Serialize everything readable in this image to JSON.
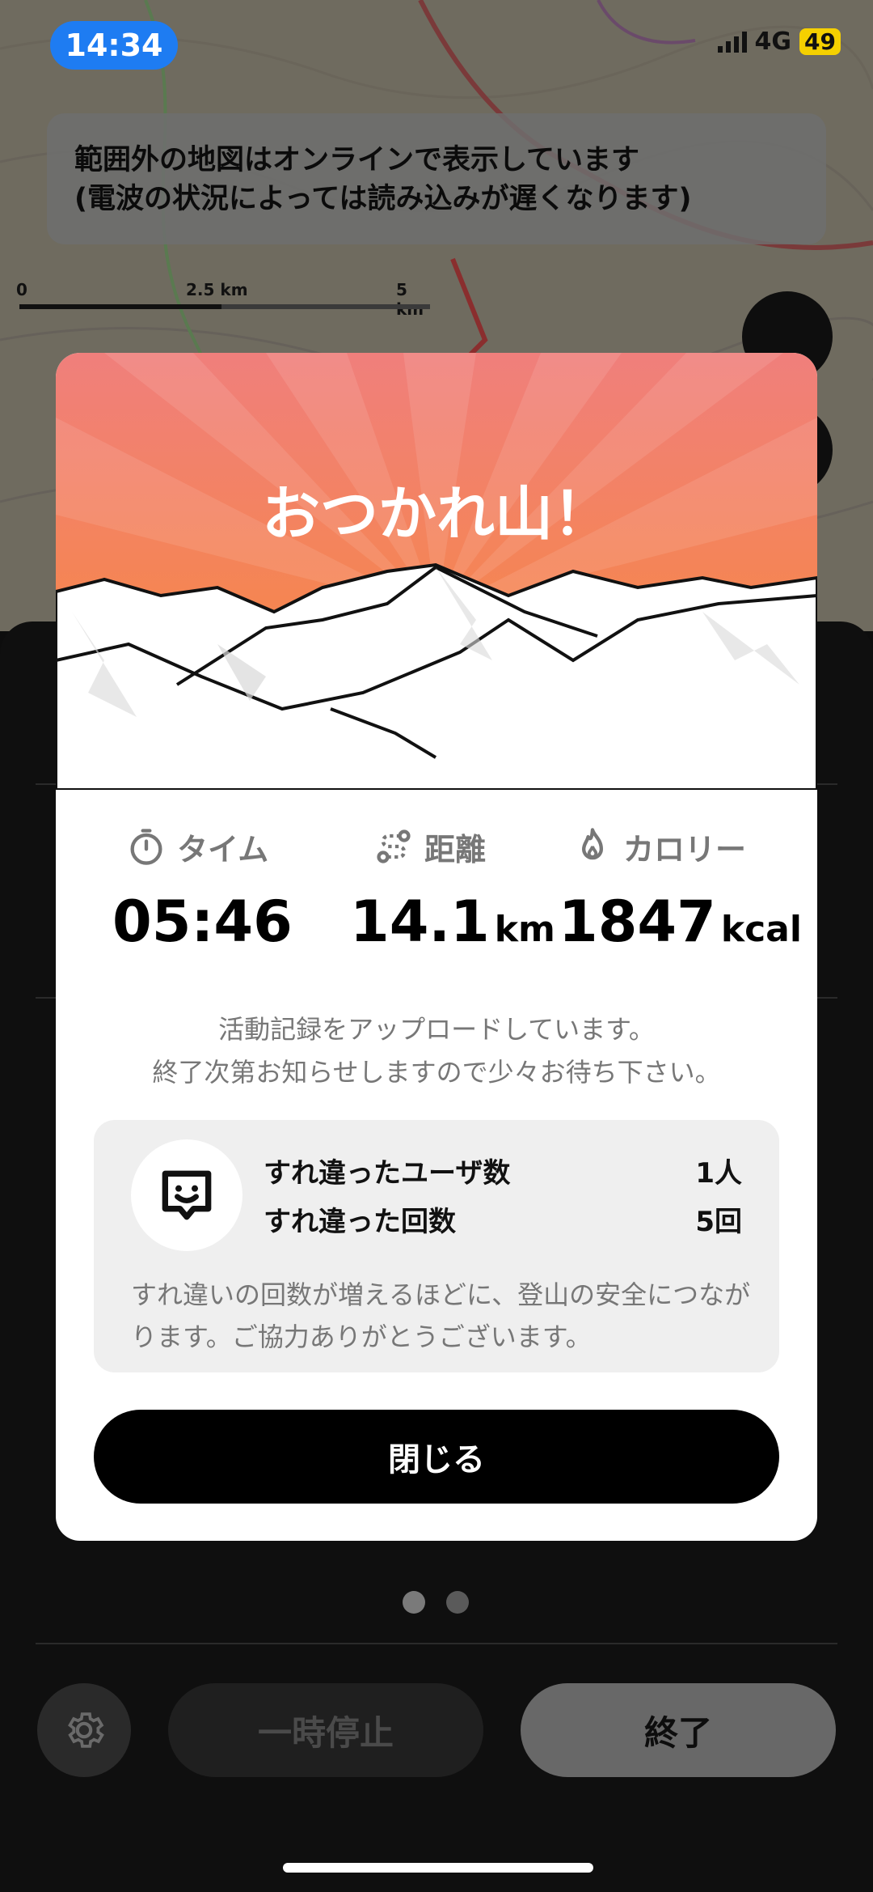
{
  "status_bar": {
    "time": "14:34",
    "network": "4G",
    "battery": "49"
  },
  "map": {
    "banner_line1": "範囲外の地図はオンラインで表示しています",
    "banner_line2": "(電波の状況によっては読み込みが遅くなります)",
    "scale": {
      "zero": "0",
      "mid": "2.5 km",
      "max": "5 km"
    }
  },
  "modal": {
    "title": "おつかれ山！",
    "stats": [
      {
        "label": "タイム",
        "value": "05:46",
        "unit": "",
        "icon": "stopwatch-icon"
      },
      {
        "label": "距離",
        "value": "14.1",
        "unit": "km",
        "icon": "route-icon"
      },
      {
        "label": "カロリー",
        "value": "1847",
        "unit": "kcal",
        "icon": "flame-icon"
      }
    ],
    "upload_line1": "活動記録をアップロードしています。",
    "upload_line2": "終了次第お知らせしますので少々お待ち下さい。",
    "encounter": {
      "users_label": "すれ違ったユーザ数",
      "users_value": "1人",
      "count_label": "すれ違った回数",
      "count_value": "5回",
      "note": "すれ違いの回数が増えるほどに、登山の安全につながります。ご協力ありがとうございます。"
    },
    "close_label": "閉じる"
  },
  "bottom": {
    "pause_label": "一時停止",
    "end_label": "終了"
  },
  "colors": {
    "hero_top": "#f38480",
    "hero_bottom": "#f98a3a",
    "accent_blue": "#1e7cf2"
  }
}
